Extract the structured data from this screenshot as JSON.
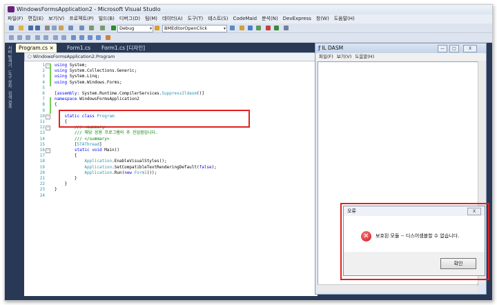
{
  "vs": {
    "title": "WindowsFormsApplication2 - Microsoft Visual Studio",
    "menu": [
      "파일(F)",
      "편집(E)",
      "보기(V)",
      "프로젝트(P)",
      "빌드(B)",
      "디버그(D)",
      "팀(M)",
      "데이터(A)",
      "도구(T)",
      "테스트(S)",
      "CodeMaid",
      "분석(N)",
      "DevExpress",
      "창(W)",
      "도움말(H)"
    ],
    "config_combo": "Debug",
    "startup_combo": "BMEditorOpenClick",
    "side_labels": [
      "서버 탐색기",
      "도구 상자",
      "검색 결과"
    ],
    "tabs": [
      "Program.cs",
      "Form1.cs",
      "Form1.cs [디자인]"
    ],
    "tab_close": "×",
    "nav_path": "WindowsFormsApplication2.Program"
  },
  "code": {
    "line_numbers": [
      "1",
      "2",
      "3",
      "4",
      "5",
      "6",
      "7",
      "8",
      "9",
      "10",
      "11",
      "12",
      "13",
      "14",
      "15",
      "16",
      "17",
      "18",
      "19",
      "20",
      "21",
      "22",
      "23",
      "24"
    ],
    "lines": [
      "using System;",
      "using System.Collections.Generic;",
      "using System.Linq;",
      "using System.Windows.Forms;",
      "",
      "[assembly: System.Runtime.CompilerServices.SuppressIldasm()]",
      "namespace WindowsFormsApplication2",
      "{",
      "",
      "    static class Program",
      "    {",
      "        /// <summary>",
      "        /// 해당 응용 프로그램의 주 진입점입니다.",
      "        /// </summary>",
      "        [STAThread]",
      "        static void Main()",
      "        {",
      "            Application.EnableVisualStyles();",
      "            Application.SetCompatibleTextRenderingDefault(false);",
      "            Application.Run(new Form1());",
      "        }",
      "    }",
      "}",
      ""
    ]
  },
  "ildasm": {
    "title": "IL DASM",
    "menu": [
      "파일(F)",
      "보기(V)",
      "도움말(H)"
    ],
    "btn_min": "—",
    "btn_max": "□",
    "btn_close": "X"
  },
  "error_dialog": {
    "title": "오류",
    "close": "X",
    "icon": "✕",
    "message": "보호된 모듈 -- 디스어셈블할 수 없습니다.",
    "ok": "확인"
  },
  "colors": {
    "vs_chrome": "#293955",
    "highlight_box": "#e02020",
    "keyword": "#0000ff",
    "type": "#2b91af",
    "comment": "#008000"
  }
}
